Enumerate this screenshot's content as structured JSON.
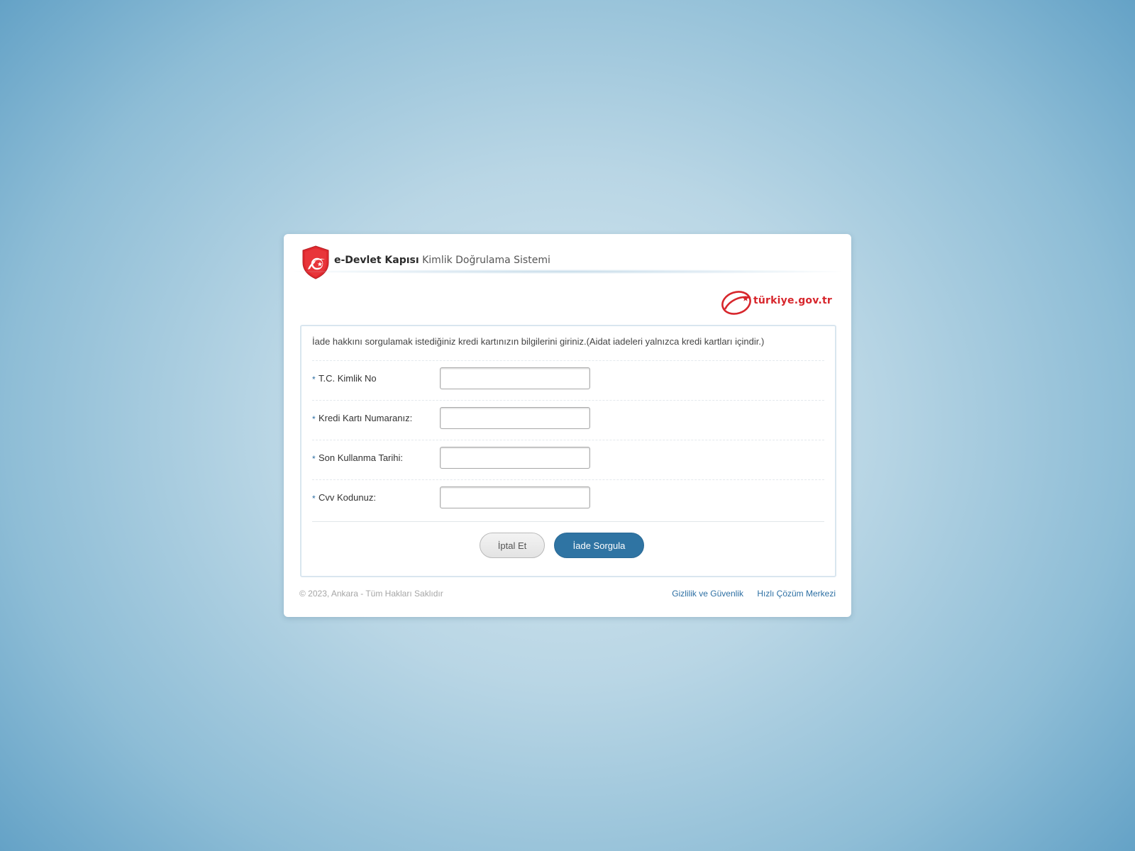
{
  "header": {
    "title_strong": "e-Devlet Kapısı",
    "title_light": "Kimlik Doğrulama Sistemi",
    "logo_icon": "edevlet-shield-icon",
    "brand_text": "türkiye.gov.tr"
  },
  "form": {
    "intro": "İade hakkını sorgulamak istediğiniz kredi kartınızın bilgilerini giriniz.(Aidat iadeleri yalnızca kredi kartları içindir.)",
    "required_mark": "*",
    "fields": [
      {
        "label": "T.C. Kimlik No",
        "value": "",
        "placeholder": ""
      },
      {
        "label": "Kredi Kartı Numaranız:",
        "value": "",
        "placeholder": ""
      },
      {
        "label": "Son Kullanma Tarihi:",
        "value": "",
        "placeholder": ""
      },
      {
        "label": "Cvv Kodunuz:",
        "value": "",
        "placeholder": ""
      }
    ],
    "cancel_label": "İptal Et",
    "submit_label": "İade Sorgula"
  },
  "footer": {
    "copyright": "© 2023, Ankara - Tüm Hakları Saklıdır",
    "links": [
      "Gizlilik ve Güvenlik",
      "Hızlı Çözüm Merkezi"
    ]
  },
  "colors": {
    "brand_red": "#d7262c",
    "primary_blue": "#2f74a3",
    "link_blue": "#2d6fa3"
  }
}
